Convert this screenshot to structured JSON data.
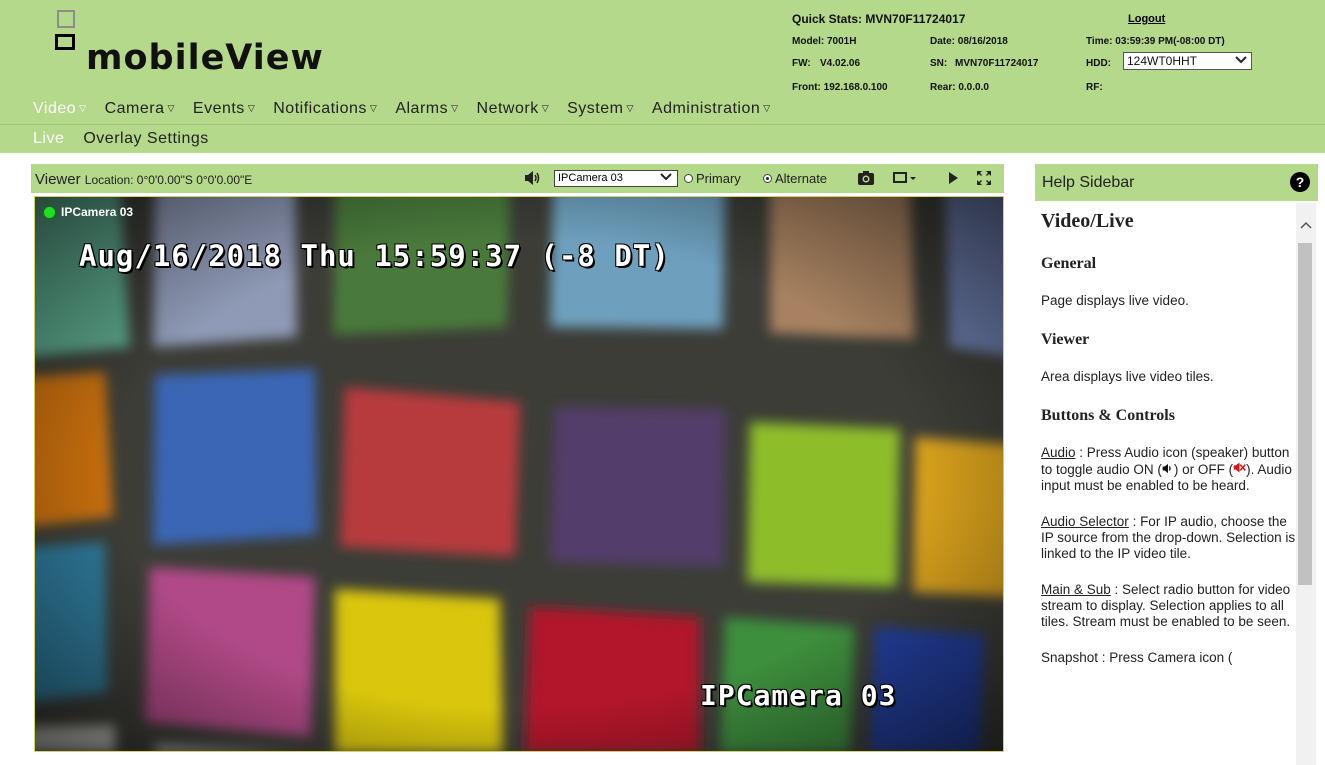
{
  "app": {
    "logo_text": "mobileView"
  },
  "stats": {
    "title": "Quick Stats: MVN70F11724017",
    "logout": "Logout",
    "model": "Model: 7001H",
    "date": "Date: 08/16/2018",
    "time": "Time: 03:59:39 PM(-08:00 DT)",
    "fw_label": "FW:",
    "fw_value": "V4.02.06",
    "sn_label": "SN:",
    "sn_value": "MVN70F11724017",
    "hdd_label": "HDD:",
    "hdd_value": "124WT0HHT",
    "front": "Front: 192.168.0.100",
    "rear": "Rear: 0.0.0.0",
    "rf": "RF:"
  },
  "menu": {
    "items": [
      {
        "label": "Video"
      },
      {
        "label": "Camera"
      },
      {
        "label": "Events"
      },
      {
        "label": "Notifications"
      },
      {
        "label": "Alarms"
      },
      {
        "label": "Network"
      },
      {
        "label": "System"
      },
      {
        "label": "Administration"
      }
    ],
    "caret": "▽"
  },
  "submenu": {
    "items": [
      {
        "label": "Live"
      },
      {
        "label": "Overlay Settings"
      }
    ]
  },
  "viewer": {
    "title": "Viewer",
    "location": "Location: 0°0'0.00\"S 0°0'0.00\"E",
    "camera_select": "IPCamera 03",
    "radio_primary": "Primary",
    "radio_alternate": "Alternate",
    "selected_stream": "Alternate"
  },
  "video": {
    "label": "IPCamera 03",
    "osd_time": "Aug/16/2018 Thu 15:59:37 (-8 DT)",
    "osd_name": "IPCamera 03"
  },
  "help": {
    "title": "Help Sidebar",
    "icon": "?",
    "heading": "Video/Live",
    "sec_general": "General",
    "general_text": "Page displays live video.",
    "sec_viewer": "Viewer",
    "viewer_text": "Area displays live video tiles.",
    "sec_buttons": "Buttons & Controls",
    "audio_link": "Audio",
    "audio_text_1": " : Press Audio icon (speaker) button to toggle audio ON (",
    "audio_text_2": ") or OFF (",
    "audio_text_3": "). Audio input must be enabled to be heard.",
    "audio_sel_link": "Audio Selector",
    "audio_sel_text": " : For IP audio, choose the IP source from the drop-down. Selection is linked to the IP video tile.",
    "main_sub_link": "Main & Sub",
    "main_sub_text": " : Select radio button for video stream to display. Selection applies to all tiles. Stream must be enabled to be seen.",
    "snapshot_text": "Snapshot : Press Camera icon ("
  },
  "colors": {
    "header_green": "#b5d98a",
    "active_menu": "#ffffff",
    "status_led": "#22dd22",
    "audio_off_red": "#e01010"
  }
}
